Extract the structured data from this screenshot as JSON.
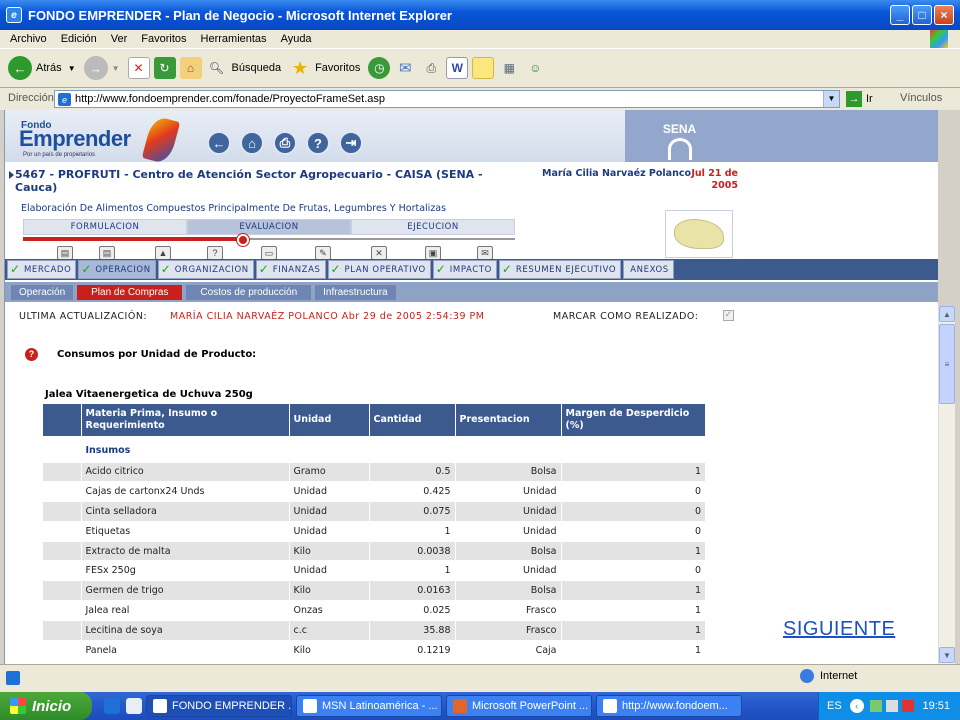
{
  "window": {
    "title": "FONDO EMPRENDER - Plan de Negocio - Microsoft Internet Explorer"
  },
  "menu": [
    "Archivo",
    "Edición",
    "Ver",
    "Favoritos",
    "Herramientas",
    "Ayuda"
  ],
  "toolbar": {
    "back": "Atrás",
    "search": "Búsqueda",
    "favorites": "Favoritos"
  },
  "address": {
    "label": "Dirección",
    "url": "http://www.fondoemprender.com/fonade/ProyectoFrameSet.asp",
    "go": "Ir",
    "links": "Vínculos"
  },
  "header": {
    "logo_top": "Fondo",
    "logo_main": "Emprender",
    "logo_tagline": "Por un país de propietarios",
    "sena": "SENA"
  },
  "project": {
    "title": "5467 - PROFRUTI - Centro de Atención Sector Agropecuario - CAISA (SENA - Cauca)",
    "user": "María Cilia Narvaéz Polanco",
    "date": "Jul 21 de 2005",
    "subtitle": "Elaboración De Alimentos Compuestos Principalmente De Frutas, Legumbres Y Hortalizas"
  },
  "phases": [
    "FORMULACION",
    "EVALUACION",
    "EJECUCION"
  ],
  "modules": [
    "MERCADO",
    "OPERACION",
    "ORGANIZACION",
    "FINANZAS",
    "PLAN OPERATIVO",
    "IMPACTO",
    "RESUMEN EJECUTIVO",
    "ANEXOS"
  ],
  "subtabs": [
    "Operación",
    "Plan de Compras",
    "Costos de producción",
    "Infraestructura"
  ],
  "info": {
    "last_update_label": "ULTIMA ACTUALIZACIÓN:",
    "last_update_value": "MARÍA CILIA NARVAÉZ POLANCO  Abr 29 de 2005 2:54:39 PM",
    "mark_done_label": "MARCAR COMO REALIZADO:"
  },
  "section": {
    "title": "Consumos por Unidad de Producto:",
    "product": "Jalea Vitaenergetica de Uchuva 250g"
  },
  "table": {
    "headers": [
      "Materia Prima, Insumo o Requerimiento",
      "Unidad",
      "Cantidad",
      "Presentacion",
      "Margen de Desperdicio (%)"
    ],
    "group": "Insumos",
    "rows": [
      [
        "Acido citrico",
        "Gramo",
        "0.5",
        "Bolsa",
        "1"
      ],
      [
        "Cajas de cartonx24 Unds",
        "Unidad",
        "0.425",
        "Unidad",
        "0"
      ],
      [
        "Cinta selladora",
        "Unidad",
        "0.075",
        "Unidad",
        "0"
      ],
      [
        "Etiquetas",
        "Unidad",
        "1",
        "Unidad",
        "0"
      ],
      [
        "Extracto de malta",
        "Kilo",
        "0.0038",
        "Bolsa",
        "1"
      ],
      [
        "FESx 250g",
        "Unidad",
        "1",
        "Unidad",
        "0"
      ],
      [
        "Germen de trigo",
        "Kilo",
        "0.0163",
        "Bolsa",
        "1"
      ],
      [
        "Jalea real",
        "Onzas",
        "0.025",
        "Frasco",
        "1"
      ],
      [
        "Lecitina de soya",
        "c.c",
        "35.88",
        "Frasco",
        "1"
      ],
      [
        "Panela",
        "Kilo",
        "0.1219",
        "Caja",
        "1"
      ]
    ]
  },
  "siguiente": "SIGUIENTE",
  "status": {
    "zone": "Internet"
  },
  "taskbar": {
    "start": "Inicio",
    "tasks": [
      "FONDO EMPRENDER ...",
      "MSN Latinoamérica - ...",
      "Microsoft PowerPoint ...",
      "http://www.fondoem..."
    ],
    "lang": "ES",
    "clock": "19:51"
  },
  "colors": {
    "accent_red": "#c8211b",
    "nav_blue": "#3d5a8f",
    "title_blue": "#1d3a80"
  }
}
